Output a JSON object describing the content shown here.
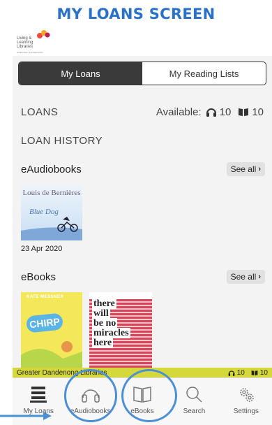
{
  "banner": {
    "title": "MY LOANS SCREEN"
  },
  "logo": {
    "line1": "Living &",
    "line2": "Learning",
    "line3": "Libraries",
    "sub": "GREATER DANDENONG"
  },
  "segments": {
    "my_loans": "My Loans",
    "my_reading_lists": "My Reading Lists"
  },
  "loans": {
    "label": "LOANS",
    "available_label": "Available:",
    "audio_count": "10",
    "ebook_count": "10"
  },
  "loan_history": {
    "label": "LOAN HISTORY"
  },
  "eaudiobooks": {
    "title": "eAudiobooks",
    "see_all": "See all",
    "items": [
      {
        "cover_author": "Louis de Bernières",
        "cover_title": "Blue Dog",
        "date": "23 Apr 2020"
      }
    ]
  },
  "ebooks": {
    "title": "eBooks",
    "see_all": "See all",
    "items": [
      {
        "cover_author": "KATE MESSNER",
        "cover_title": "CHIRP"
      },
      {
        "cover_title_lines": [
          "there",
          "will",
          "be no",
          "miracles",
          "here"
        ]
      }
    ]
  },
  "status_bar": {
    "library": "Greater Dandenong Libraries",
    "audio_count": "10",
    "ebook_count": "10"
  },
  "tabs": [
    {
      "label": "My Loans",
      "icon": "stack-icon"
    },
    {
      "label": "eAudiobooks",
      "icon": "headphones-icon"
    },
    {
      "label": "eBooks",
      "icon": "book-icon"
    },
    {
      "label": "Search",
      "icon": "search-icon"
    },
    {
      "label": "Settings",
      "icon": "gear-icon"
    }
  ],
  "colors": {
    "banner": "#2a72c8",
    "highlight_circle": "#4d8fd4",
    "status_bar": "#d5d83b"
  }
}
